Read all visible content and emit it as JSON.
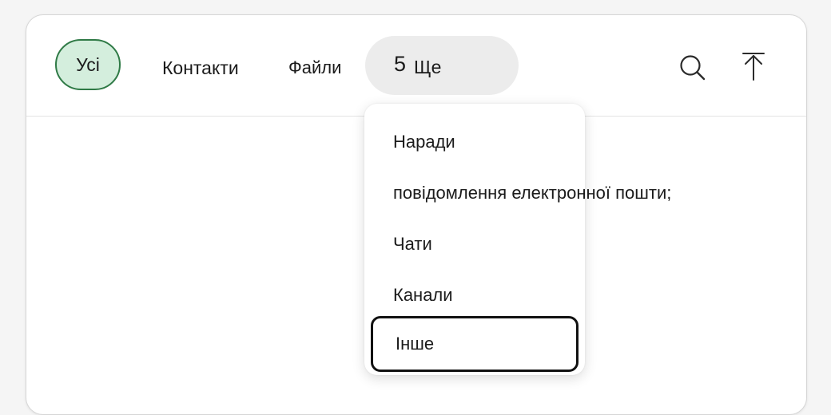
{
  "tabs": {
    "all": "Усі",
    "contacts": "Контакти",
    "files": "Файли",
    "more_count": "5",
    "more_label": "Ще"
  },
  "icons": {
    "search": "search-icon",
    "upload": "upload-icon"
  },
  "colors": {
    "selected_tab_bg": "#d4eedd",
    "selected_tab_border": "#2f7a46",
    "more_tab_bg": "#ececec",
    "focus_outline": "#111111"
  },
  "dropdown": {
    "items": [
      {
        "label": "Наради"
      },
      {
        "label": "повідомлення електронної пошти;"
      },
      {
        "label": "Чати"
      },
      {
        "label": "Канали"
      },
      {
        "label": "Інше",
        "focused": true
      }
    ]
  }
}
